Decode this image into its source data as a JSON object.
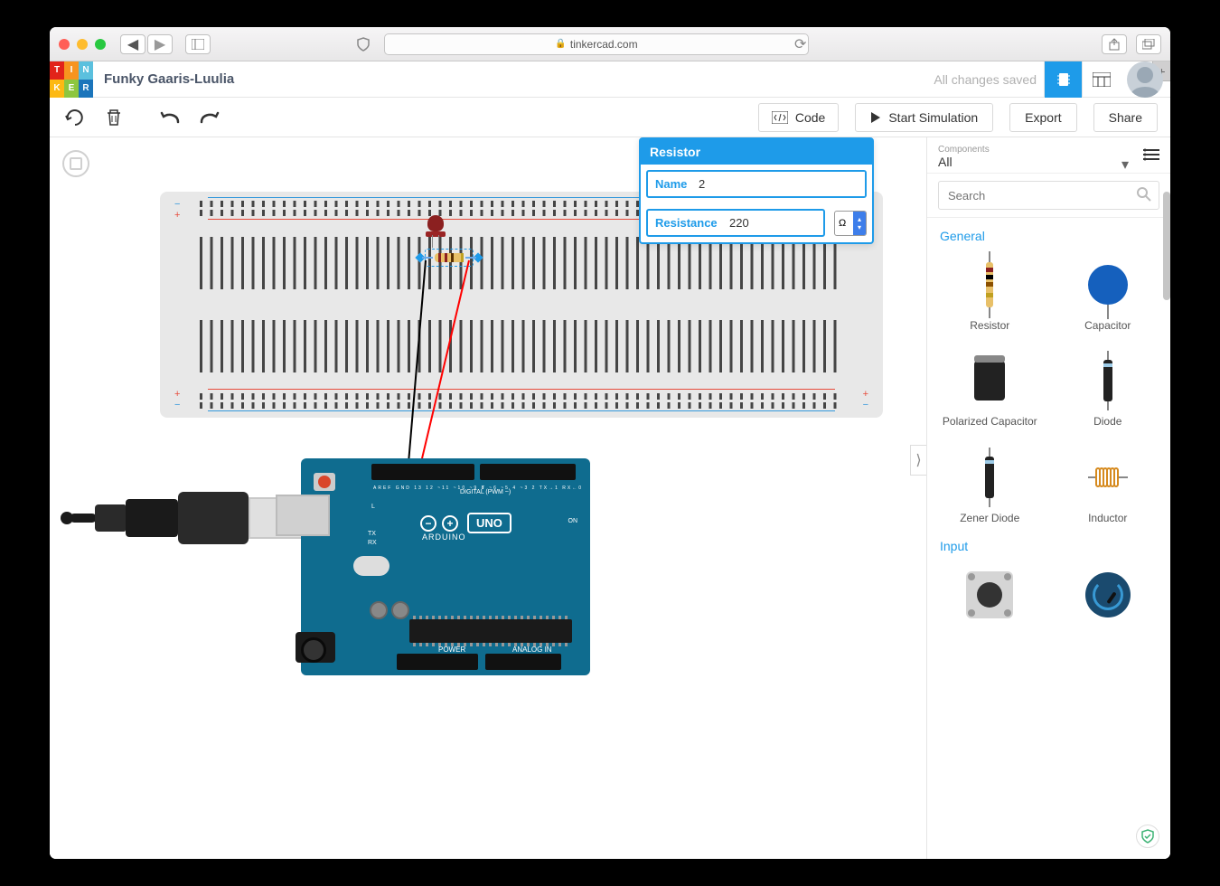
{
  "browser": {
    "url_host": "tinkercad.com"
  },
  "header": {
    "logo": [
      "T",
      "I",
      "N",
      "K",
      "E",
      "R"
    ],
    "project_title": "Funky Gaaris-Luulia",
    "save_status": "All changes saved"
  },
  "toolbar": {
    "code_label": "Code",
    "sim_label": "Start Simulation",
    "export_label": "Export",
    "share_label": "Share"
  },
  "inspector": {
    "title": "Resistor",
    "name_label": "Name",
    "name_value": "2",
    "resistance_label": "Resistance",
    "resistance_value": "220",
    "resistance_unit": "Ω"
  },
  "sidebar": {
    "dropdown_label": "Components",
    "dropdown_value": "All",
    "search_placeholder": "Search",
    "sections": [
      {
        "title": "General",
        "items": [
          "Resistor",
          "Capacitor",
          "Polarized Capacitor",
          "Diode",
          "Zener Diode",
          "Inductor"
        ]
      },
      {
        "title": "Input",
        "items": [
          "Pushbutton",
          "Potentiometer"
        ]
      }
    ]
  },
  "canvas_components": {
    "breadboard": true,
    "led": {
      "color": "red"
    },
    "resistor": {
      "value": 220,
      "selected": true
    },
    "wires": [
      {
        "color": "#000",
        "from": "breadboard",
        "to": "arduino-gnd"
      },
      {
        "color": "#f00",
        "from": "resistor-right",
        "to": "arduino-d13"
      }
    ],
    "arduino_model": "UNO",
    "arduino_text": "ARDUINO",
    "digital_label": "DIGITAL (PWM ~)",
    "power_label": "POWER",
    "analog_label": "ANALOG IN"
  }
}
